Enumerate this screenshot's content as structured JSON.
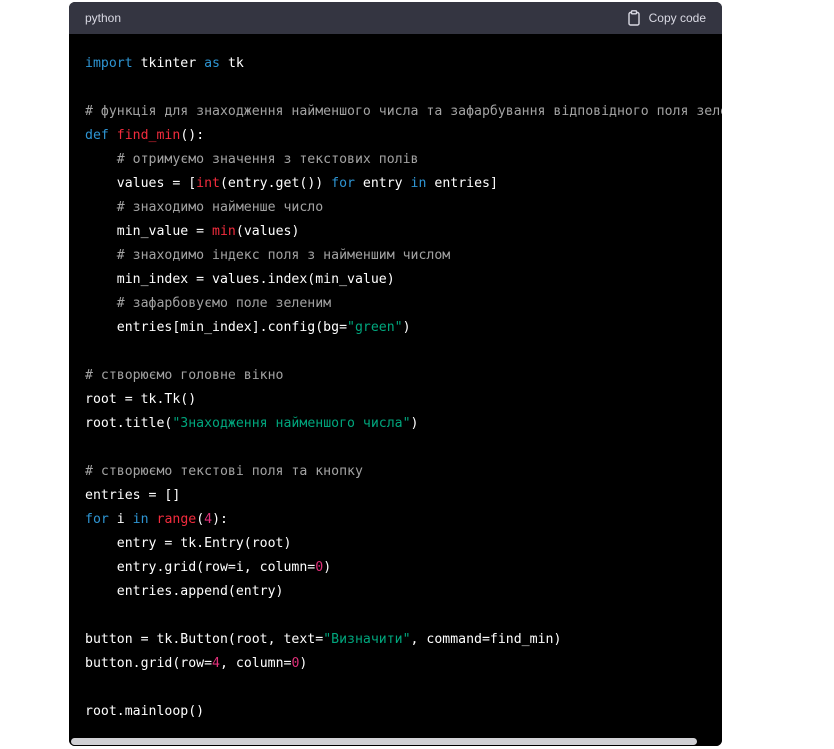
{
  "code_block": {
    "language": "python",
    "copy_label": "Copy code",
    "lines": [
      [
        {
          "t": "import",
          "c": "kw"
        },
        {
          "t": " tkinter ",
          "c": "txt"
        },
        {
          "t": "as",
          "c": "kw"
        },
        {
          "t": " tk",
          "c": "txt"
        }
      ],
      [],
      [
        {
          "t": "# функція для знаходження найменшого числа та зафарбування відповідного поля зеленим",
          "c": "cm"
        }
      ],
      [
        {
          "t": "def",
          "c": "kw"
        },
        {
          "t": " ",
          "c": "txt"
        },
        {
          "t": "find_min",
          "c": "fn"
        },
        {
          "t": "():",
          "c": "txt"
        }
      ],
      [
        {
          "t": "    # отримуємо значення з текстових полів",
          "c": "cm"
        }
      ],
      [
        {
          "t": "    values = [",
          "c": "txt"
        },
        {
          "t": "int",
          "c": "fn"
        },
        {
          "t": "(entry.get()) ",
          "c": "txt"
        },
        {
          "t": "for",
          "c": "kw"
        },
        {
          "t": " entry ",
          "c": "txt"
        },
        {
          "t": "in",
          "c": "kw"
        },
        {
          "t": " entries]",
          "c": "txt"
        }
      ],
      [
        {
          "t": "    # знаходимо найменше число",
          "c": "cm"
        }
      ],
      [
        {
          "t": "    min_value = ",
          "c": "txt"
        },
        {
          "t": "min",
          "c": "fn"
        },
        {
          "t": "(values)",
          "c": "txt"
        }
      ],
      [
        {
          "t": "    # знаходимо індекс поля з найменшим числом",
          "c": "cm"
        }
      ],
      [
        {
          "t": "    min_index = values.index(min_value)",
          "c": "txt"
        }
      ],
      [
        {
          "t": "    # зафарбовуємо поле зеленим",
          "c": "cm"
        }
      ],
      [
        {
          "t": "    entries[min_index].config(bg=",
          "c": "txt"
        },
        {
          "t": "\"green\"",
          "c": "str"
        },
        {
          "t": ")",
          "c": "txt"
        }
      ],
      [],
      [
        {
          "t": "# створюємо головне вікно",
          "c": "cm"
        }
      ],
      [
        {
          "t": "root = tk.Tk()",
          "c": "txt"
        }
      ],
      [
        {
          "t": "root.title(",
          "c": "txt"
        },
        {
          "t": "\"Знаходження найменшого числа\"",
          "c": "str"
        },
        {
          "t": ")",
          "c": "txt"
        }
      ],
      [],
      [
        {
          "t": "# створюємо текстові поля та кнопку",
          "c": "cm"
        }
      ],
      [
        {
          "t": "entries = []",
          "c": "txt"
        }
      ],
      [
        {
          "t": "for",
          "c": "kw"
        },
        {
          "t": " i ",
          "c": "txt"
        },
        {
          "t": "in",
          "c": "kw"
        },
        {
          "t": " ",
          "c": "txt"
        },
        {
          "t": "range",
          "c": "fn"
        },
        {
          "t": "(",
          "c": "txt"
        },
        {
          "t": "4",
          "c": "num"
        },
        {
          "t": "):",
          "c": "txt"
        }
      ],
      [
        {
          "t": "    entry = tk.Entry(root)",
          "c": "txt"
        }
      ],
      [
        {
          "t": "    entry.grid(row=i, column=",
          "c": "txt"
        },
        {
          "t": "0",
          "c": "num"
        },
        {
          "t": ")",
          "c": "txt"
        }
      ],
      [
        {
          "t": "    entries.append(entry)",
          "c": "txt"
        }
      ],
      [],
      [
        {
          "t": "button = tk.Button(root, text=",
          "c": "txt"
        },
        {
          "t": "\"Визначити\"",
          "c": "str"
        },
        {
          "t": ", command=find_min)",
          "c": "txt"
        }
      ],
      [
        {
          "t": "button.grid(row=",
          "c": "txt"
        },
        {
          "t": "4",
          "c": "num"
        },
        {
          "t": ", column=",
          "c": "txt"
        },
        {
          "t": "0",
          "c": "num"
        },
        {
          "t": ")",
          "c": "txt"
        }
      ],
      [],
      [
        {
          "t": "root.mainloop()",
          "c": "txt"
        }
      ]
    ]
  },
  "icons": {
    "copy": "clipboard-icon"
  },
  "colors": {
    "header_bg": "#343541",
    "code_bg": "#000000",
    "keyword": "#2e95d3",
    "function": "#f22c3d",
    "string": "#00a67d",
    "number": "#df3079",
    "comment": "#a3a3a3"
  }
}
